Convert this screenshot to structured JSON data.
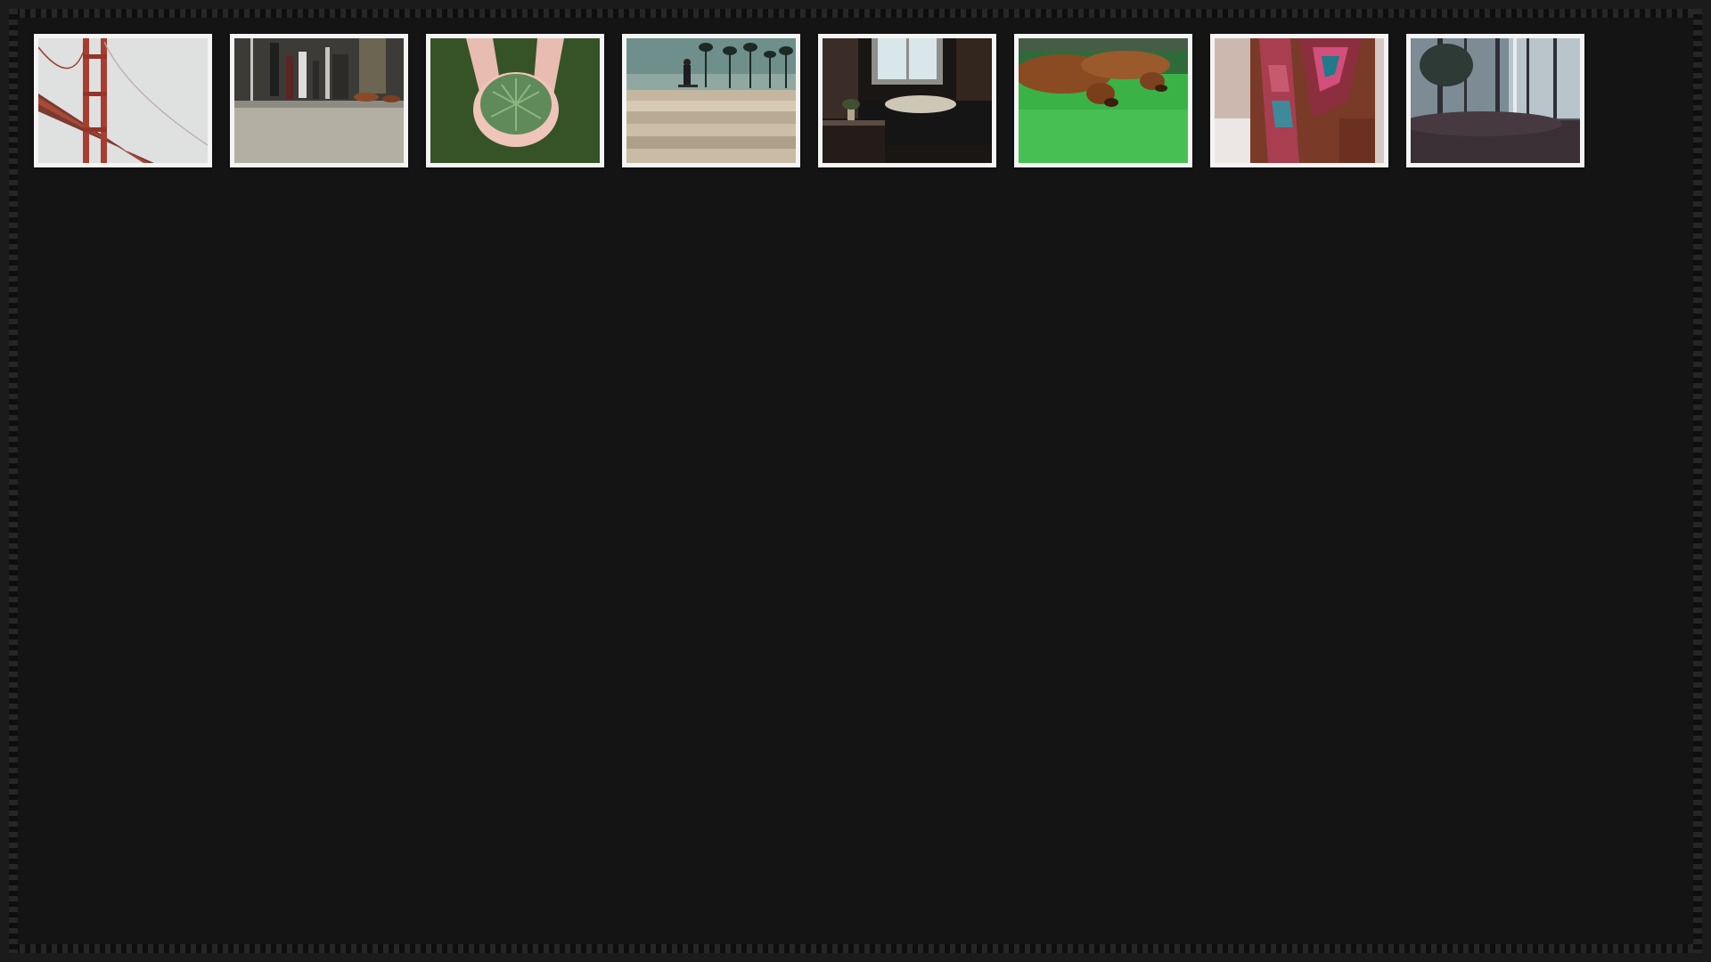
{
  "gallery": {
    "thumbnails": [
      {
        "subject": "golden-gate-bridge-in-fog",
        "accent": "#b5432f"
      },
      {
        "subject": "subway-car-floor",
        "accent": "#8a8a82"
      },
      {
        "subject": "hands-holding-pine-needles",
        "accent": "#4d7a45"
      },
      {
        "subject": "skateboarder-palm-trees",
        "accent": "#3c6b66"
      },
      {
        "subject": "dark-room-window-sofa",
        "accent": "#2a2a2a"
      },
      {
        "subject": "dachshunds-on-grass",
        "accent": "#3bb54a"
      },
      {
        "subject": "woman-in-patterned-scarf",
        "accent": "#c0506d"
      },
      {
        "subject": "misty-forest",
        "accent": "#5e6e7a"
      }
    ]
  }
}
